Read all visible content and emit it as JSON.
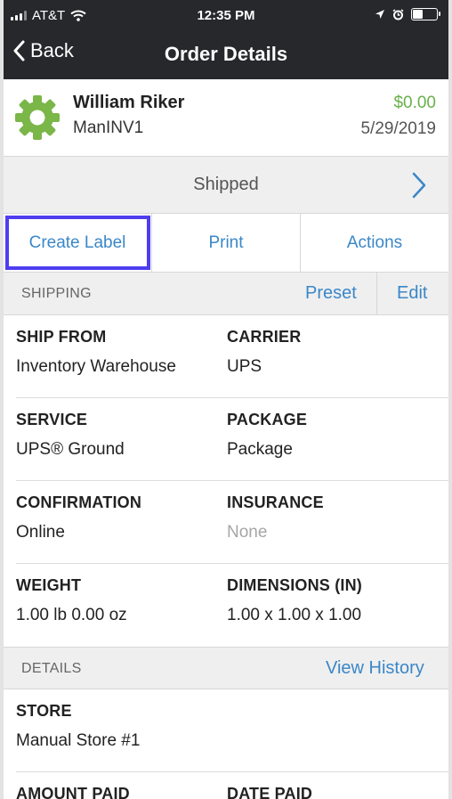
{
  "status_bar": {
    "carrier": "AT&T",
    "time": "12:35 PM"
  },
  "nav": {
    "back_label": "Back",
    "title": "Order Details"
  },
  "customer": {
    "name": "William Riker",
    "order_id": "ManINV1",
    "amount": "$0.00",
    "date": "5/29/2019"
  },
  "order_status": "Shipped",
  "actions": {
    "create_label": "Create Label",
    "print": "Print",
    "actions": "Actions"
  },
  "shipping": {
    "header": "SHIPPING",
    "preset_label": "Preset",
    "edit_label": "Edit",
    "fields": {
      "ship_from": {
        "label": "SHIP FROM",
        "value": "Inventory Warehouse"
      },
      "carrier": {
        "label": "CARRIER",
        "value": "UPS"
      },
      "service": {
        "label": "SERVICE",
        "value": "UPS® Ground"
      },
      "package": {
        "label": "PACKAGE",
        "value": "Package"
      },
      "confirmation": {
        "label": "CONFIRMATION",
        "value": "Online"
      },
      "insurance": {
        "label": "INSURANCE",
        "value": "None"
      },
      "weight": {
        "label": "WEIGHT",
        "value": "1.00 lb 0.00 oz"
      },
      "dimensions": {
        "label": "DIMENSIONS (IN)",
        "value": "1.00 x 1.00 x 1.00"
      }
    }
  },
  "details": {
    "header": "DETAILS",
    "view_history_label": "View History",
    "store": {
      "label": "STORE",
      "value": "Manual Store #1"
    },
    "amount_paid_label": "AMOUNT PAID",
    "date_paid_label": "DATE PAID"
  },
  "colors": {
    "accent": "#3a87c8",
    "amount_green": "#6ab04c",
    "highlight": "#4f3df0",
    "topbar": "#26282b",
    "gear": "#7ab648"
  },
  "icons": [
    "signal-icon",
    "wifi-icon",
    "location-icon",
    "alarm-icon",
    "battery-icon",
    "back-chevron-icon",
    "gear-icon",
    "chevron-right-icon"
  ]
}
